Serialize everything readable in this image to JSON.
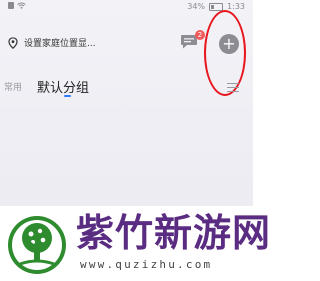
{
  "status_bar": {
    "battery_percent": "34%",
    "time": "1:33"
  },
  "header": {
    "location_placeholder": "设置家庭位置显...",
    "message_badge_count": "2",
    "add_symbol": "+"
  },
  "tabs": {
    "common_label": "常用",
    "default_group_label": "默认分组"
  },
  "watermark": {
    "brand_name": "紫竹新游网",
    "url": "www.quzizhu.com"
  },
  "colors": {
    "annotation": "#e8161d",
    "brand": "#5a2d82",
    "logo_green": "#2e8b2e",
    "tab_indicator": "#2f7bff",
    "badge": "#f15b5b"
  },
  "icons": {
    "location": "location-pin-icon",
    "messages": "message-bubble-icon",
    "add": "plus-circle-icon",
    "menu": "hamburger-menu-icon",
    "logo": "tree-logo-icon"
  }
}
